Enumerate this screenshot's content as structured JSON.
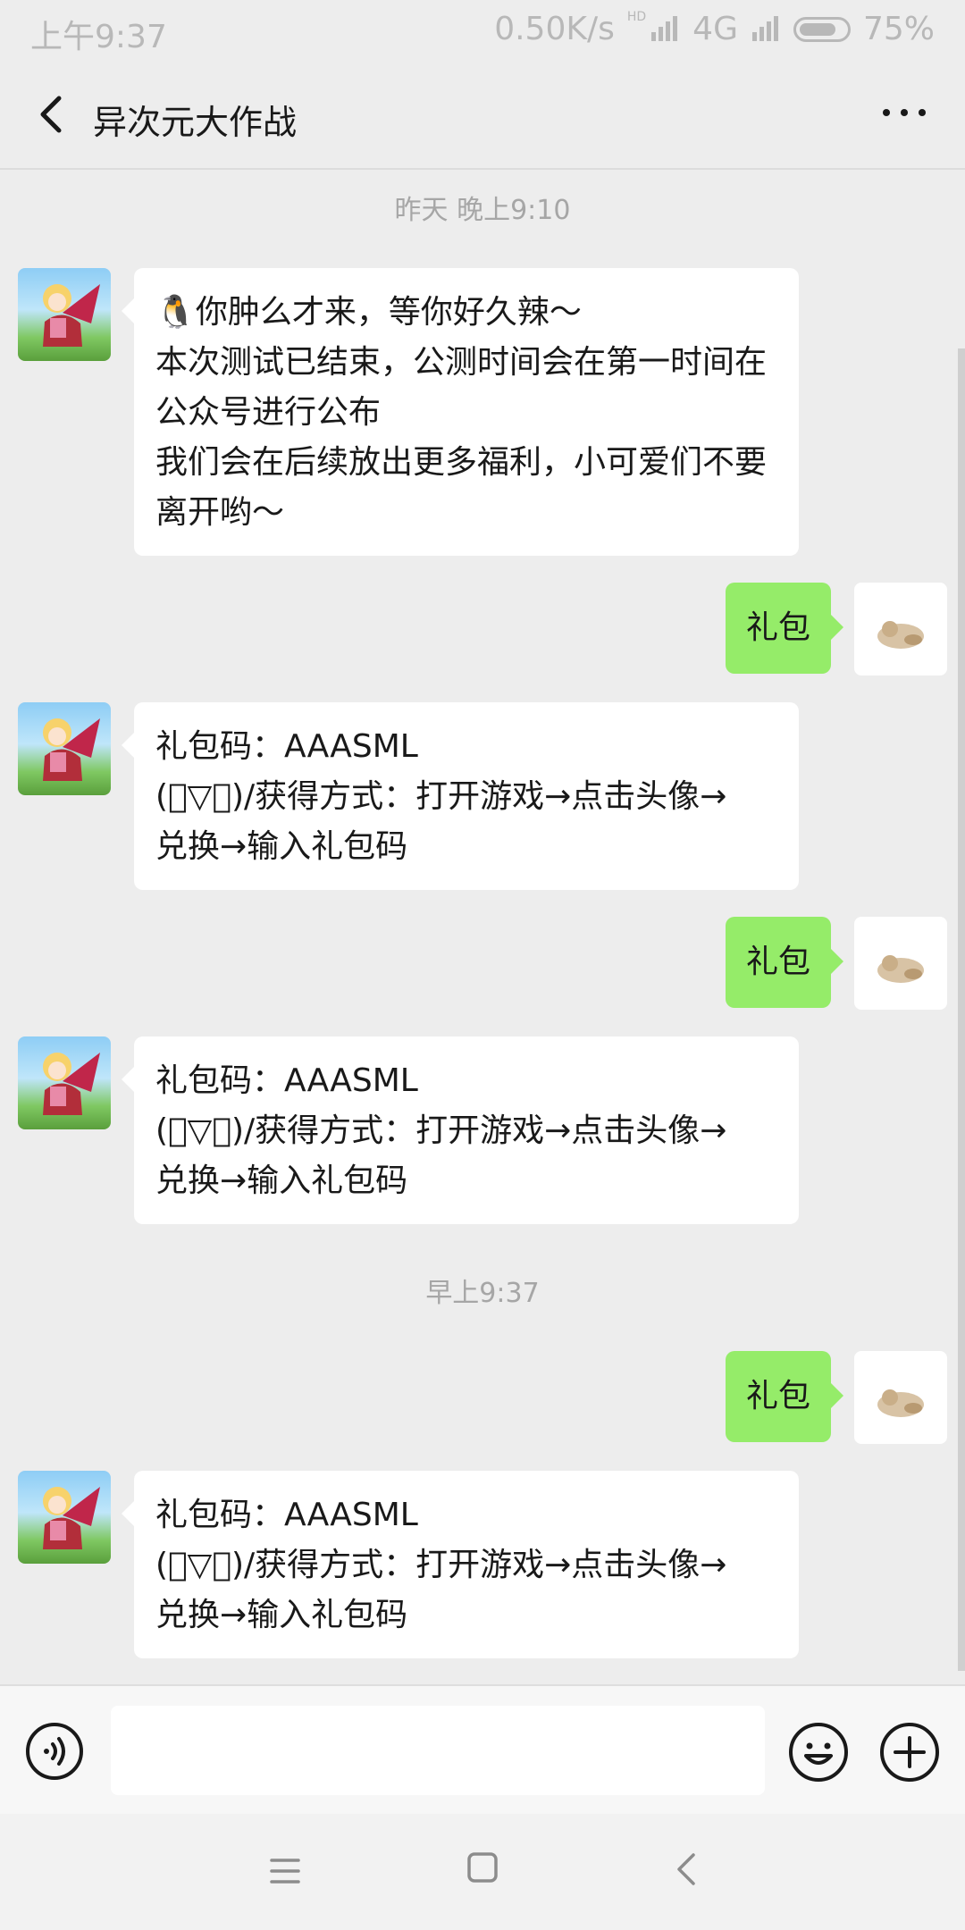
{
  "status_bar": {
    "time": "上午9:37",
    "speed": "0.50K/s",
    "hd": "HD",
    "network": "4G",
    "battery": "75%"
  },
  "header": {
    "title": "异次元大作战",
    "back_icon": "chevron-left-icon",
    "more_icon": "ellipsis-icon"
  },
  "timestamps": {
    "t1": "昨天 晚上9:10",
    "t2": "早上9:37"
  },
  "messages": {
    "m1": {
      "sender": "official",
      "emoji": "🐧",
      "lines": [
        "你肿么才来，等你好久辣～",
        "本次测试已结束，公测时间会在第一时间在",
        "公众号进行公布",
        "我们会在后续放出更多福利，小可爱们不要",
        "离开哟～"
      ]
    },
    "m2": {
      "sender": "me",
      "text": "礼包"
    },
    "m3": {
      "sender": "official",
      "lines": [
        "礼包码：AAASML",
        "(ﾟ▽ﾟ)/获得方式：打开游戏→点击头像→",
        "兑换→输入礼包码"
      ]
    },
    "m4": {
      "sender": "me",
      "text": "礼包"
    },
    "m5": {
      "sender": "official",
      "lines": [
        "礼包码：AAASML",
        "(ﾟ▽ﾟ)/获得方式：打开游戏→点击头像→",
        "兑换→输入礼包码"
      ]
    },
    "m6": {
      "sender": "me",
      "text": "礼包"
    },
    "m7": {
      "sender": "official",
      "lines": [
        "礼包码：AAASML",
        "(ﾟ▽ﾟ)/获得方式：打开游戏→点击头像→",
        "兑换→输入礼包码"
      ]
    }
  },
  "input_bar": {
    "value": "",
    "voice_icon": "voice-icon",
    "emoji_icon": "emoji-icon",
    "plus_icon": "plus-icon"
  },
  "nav_bar": {
    "menu_icon": "menu-icon",
    "home_icon": "home-icon",
    "back_icon": "back-icon"
  },
  "colors": {
    "background": "#ededed",
    "my_bubble": "#95ec69",
    "their_bubble": "#ffffff",
    "timestamp": "#a6a6a6"
  }
}
